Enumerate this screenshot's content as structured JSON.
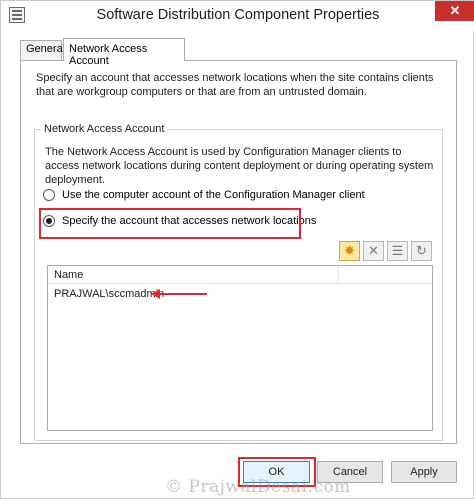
{
  "window": {
    "title": "Software Distribution Component Properties",
    "close_glyph": "✕"
  },
  "tabs": [
    {
      "label": "General",
      "selected": false
    },
    {
      "label": "Network Access Account",
      "selected": true
    }
  ],
  "intro_text": "Specify an account that accesses network locations when the site contains clients that are workgroup computers or that are from an untrusted domain.",
  "group": {
    "legend": "Network Access Account",
    "description": "The Network Access Account is used by Configuration Manager clients to access network locations during content deployment or during operating system deployment.",
    "options": [
      {
        "label": "Use the computer account of the Configuration Manager client",
        "selected": false
      },
      {
        "label": "Specify the account that accesses network locations",
        "selected": true
      }
    ]
  },
  "toolbar": {
    "icons": [
      "new-star-icon",
      "delete-x-icon",
      "properties-icon",
      "refresh-icon"
    ],
    "glyphs": [
      "✸",
      "✕",
      "☰",
      "↻"
    ]
  },
  "list": {
    "columns": [
      "Name"
    ],
    "rows": [
      "PRAJWAL\\sccmadmin"
    ]
  },
  "buttons": {
    "ok": "OK",
    "cancel": "Cancel",
    "apply": "Apply"
  },
  "watermark": "© PrajwalDesai.com",
  "colors": {
    "annotation_red": "#e0262f",
    "close_red": "#c7302b",
    "ok_focus_blue": "#3c7fb1"
  }
}
